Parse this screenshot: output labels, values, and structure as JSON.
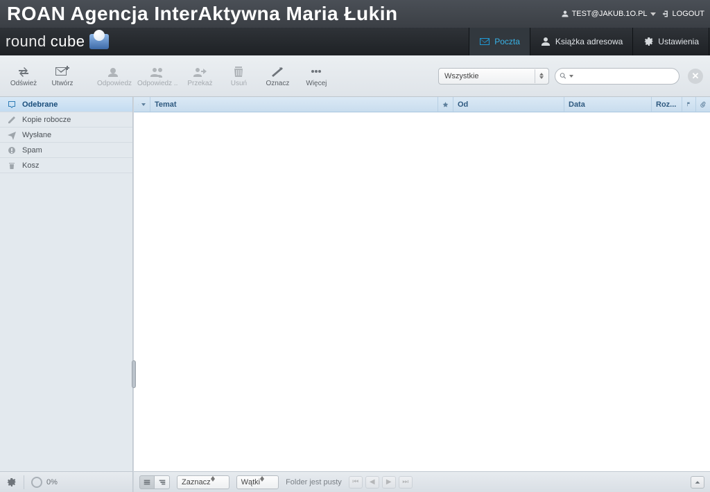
{
  "banner": {
    "title": "ROAN Agencja InterAktywna Maria Łukin",
    "user": "TEST@JAKUB.1O.PL",
    "logout": "LOGOUT"
  },
  "brand": {
    "left": "round",
    "right": "cube"
  },
  "nav": {
    "mail": "Poczta",
    "addressbook": "Książka adresowa",
    "settings": "Ustawienia"
  },
  "toolbar": {
    "refresh": "Odśwież",
    "compose": "Utwórz",
    "reply": "Odpowiedz",
    "replyall": "Odpowiedz ..",
    "forward": "Przekaż",
    "delete": "Usuń",
    "mark": "Oznacz",
    "more": "Więcej",
    "filter_selected": "Wszystkie",
    "search_placeholder": ""
  },
  "folders": {
    "inbox": "Odebrane",
    "drafts": "Kopie robocze",
    "sent": "Wysłane",
    "spam": "Spam",
    "trash": "Kosz"
  },
  "columns": {
    "subject": "Temat",
    "from": "Od",
    "date": "Data",
    "size": "Roz..."
  },
  "footer": {
    "select_label": "Zaznacz",
    "threads_label": "Wątki",
    "status": "Folder jest pusty",
    "quota": "0%"
  }
}
